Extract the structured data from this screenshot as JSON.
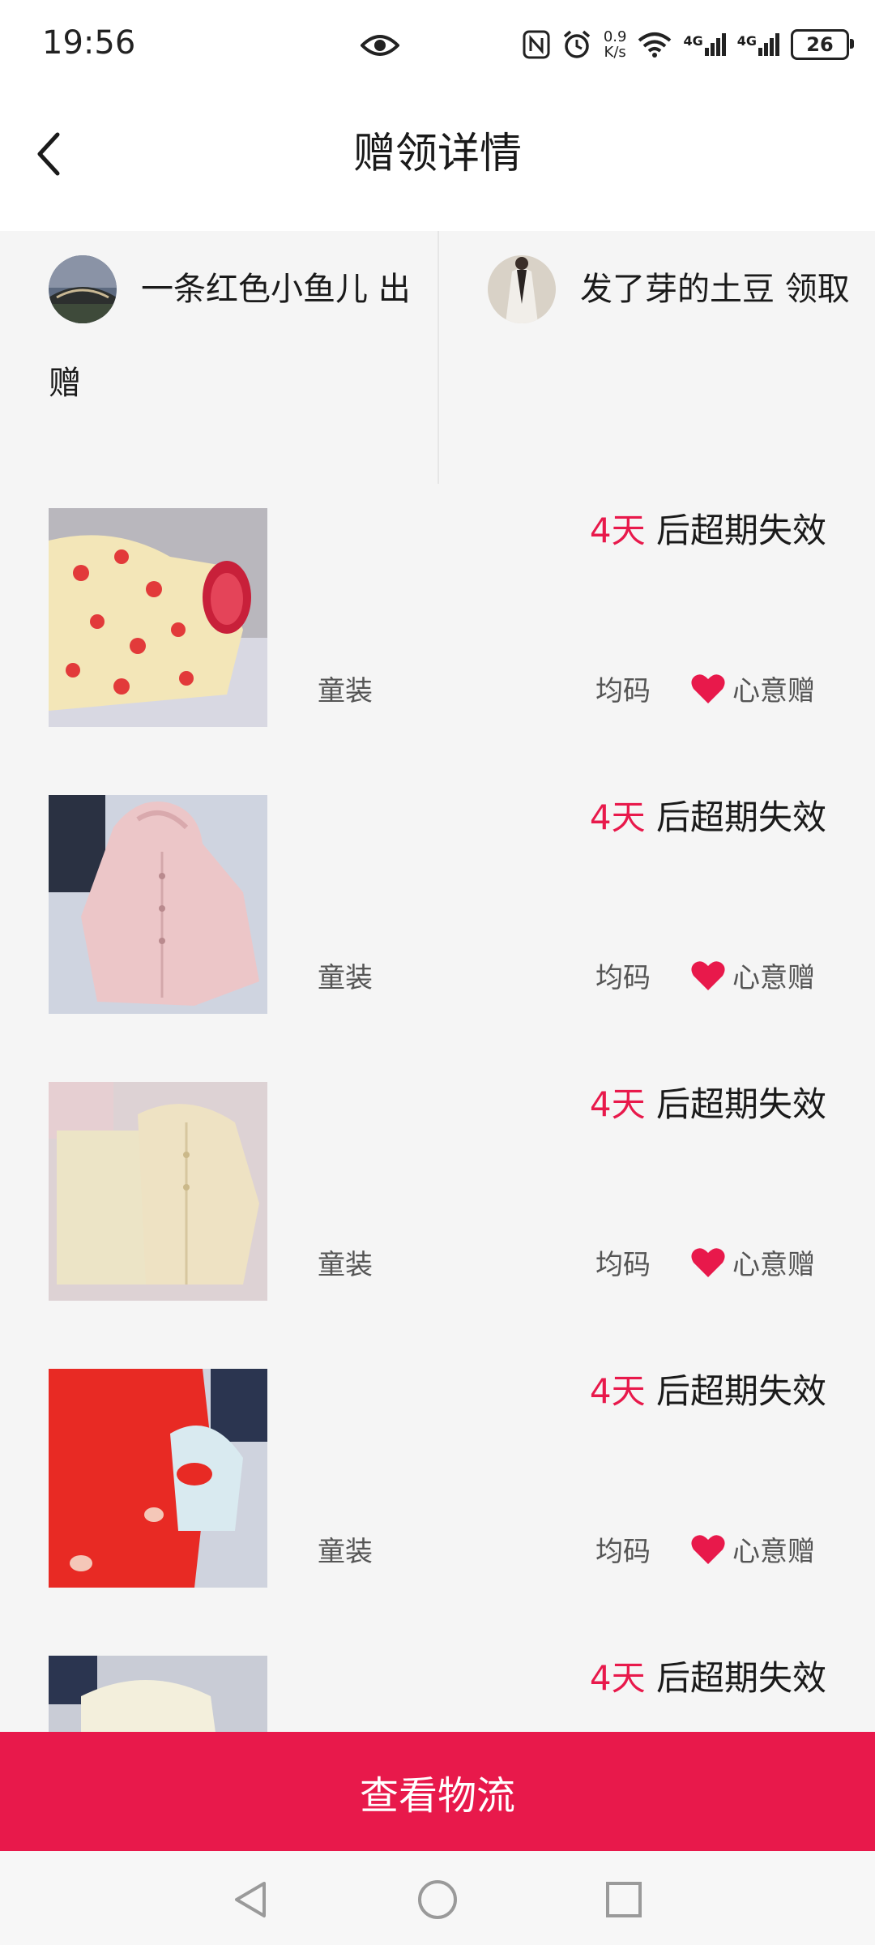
{
  "status_bar": {
    "time": "19:56",
    "net_speed_value": "0.9",
    "net_speed_unit": "K/s",
    "signal1": "4G",
    "signal2": "4G",
    "battery": "26"
  },
  "header": {
    "title": "赠领详情"
  },
  "users": {
    "giver": {
      "name": "一条红色小鱼儿",
      "action_line1": "出",
      "action_line2": "赠"
    },
    "receiver": {
      "name": "发了芽的土豆",
      "action": "领取"
    }
  },
  "items": [
    {
      "expire_days": "4天",
      "expire_text": " 后超期失效",
      "category": "童装",
      "size": "均码",
      "gift_type": "心意赠"
    },
    {
      "expire_days": "4天",
      "expire_text": " 后超期失效",
      "category": "童装",
      "size": "均码",
      "gift_type": "心意赠"
    },
    {
      "expire_days": "4天",
      "expire_text": " 后超期失效",
      "category": "童装",
      "size": "均码",
      "gift_type": "心意赠"
    },
    {
      "expire_days": "4天",
      "expire_text": " 后超期失效",
      "category": "童装",
      "size": "均码",
      "gift_type": "心意赠"
    },
    {
      "expire_days": "4天",
      "expire_text": " 后超期失效",
      "category": "",
      "size": "",
      "gift_type": ""
    }
  ],
  "footer": {
    "button_label": "查看物流"
  },
  "colors": {
    "accent": "#e8194b",
    "page_bg": "#f5f5f5"
  },
  "icons": [
    "back-arrow-icon",
    "eye-icon",
    "nfc-icon",
    "alarm-icon",
    "wifi-icon",
    "signal-icon",
    "battery-icon",
    "heart-icon",
    "nav-back-icon",
    "nav-home-icon",
    "nav-recents-icon"
  ]
}
